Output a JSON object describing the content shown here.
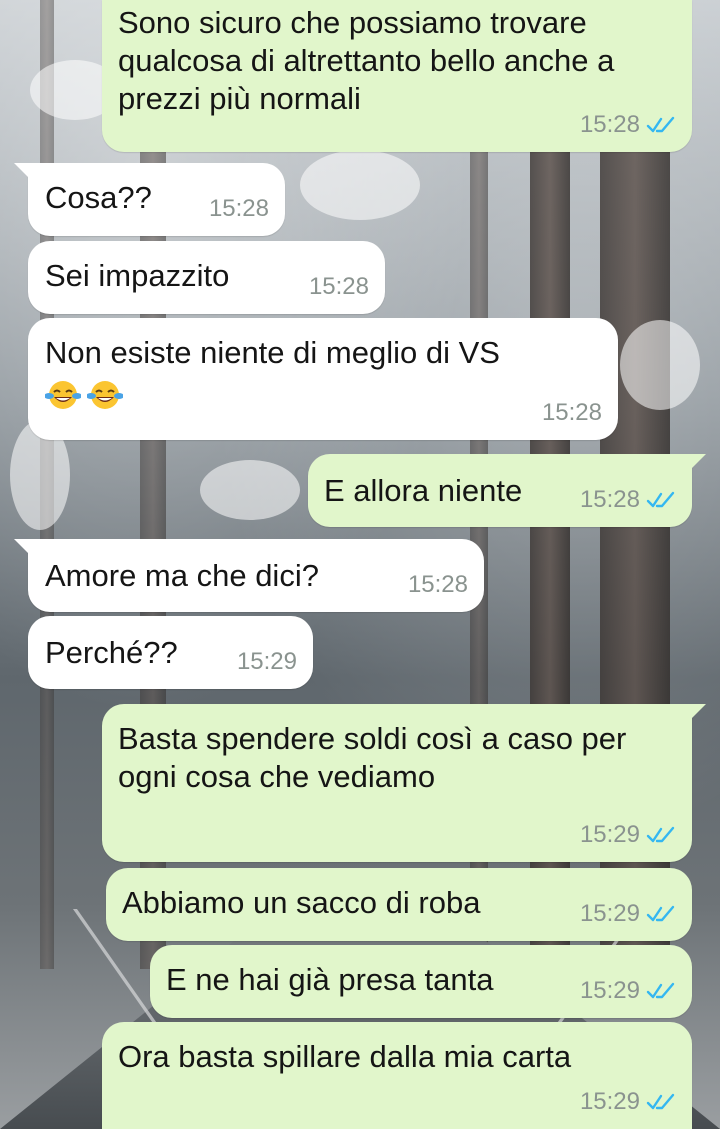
{
  "colors": {
    "outgoing_bubble": "#e1f6cb",
    "incoming_bubble": "#ffffff",
    "read_ticks": "#34b7f1",
    "timestamp": "#8a938f"
  },
  "messages": [
    {
      "direction": "outgoing",
      "text": "Sono sicuro che possiamo trovare qualcosa di altrettanto bello anche a prezzi più normali",
      "time": "15:28",
      "status_icon": "double-check-read-icon"
    },
    {
      "direction": "incoming",
      "text": "Cosa??",
      "time": "15:28"
    },
    {
      "direction": "incoming",
      "text": "Sei impazzito",
      "time": "15:28"
    },
    {
      "direction": "incoming",
      "text": "Non esiste niente di meglio di VS",
      "emoji": "😂😂",
      "emoji_name": "face-with-tears-of-joy-icon",
      "time": "15:28"
    },
    {
      "direction": "outgoing",
      "text": "E allora niente",
      "time": "15:28",
      "status_icon": "double-check-read-icon"
    },
    {
      "direction": "incoming",
      "text": "Amore ma che dici?",
      "time": "15:28"
    },
    {
      "direction": "incoming",
      "text": "Perché??",
      "time": "15:29"
    },
    {
      "direction": "outgoing",
      "text": "Basta spendere soldi così a caso per ogni cosa che vediamo",
      "time": "15:29",
      "status_icon": "double-check-read-icon"
    },
    {
      "direction": "outgoing",
      "text": "Abbiamo un sacco di roba",
      "time": "15:29",
      "status_icon": "double-check-read-icon"
    },
    {
      "direction": "outgoing",
      "text": "E ne hai già presa tanta",
      "time": "15:29",
      "status_icon": "double-check-read-icon"
    },
    {
      "direction": "outgoing",
      "text": "Ora basta spillare dalla mia carta",
      "time": "15:29",
      "status_icon": "double-check-read-icon"
    }
  ]
}
